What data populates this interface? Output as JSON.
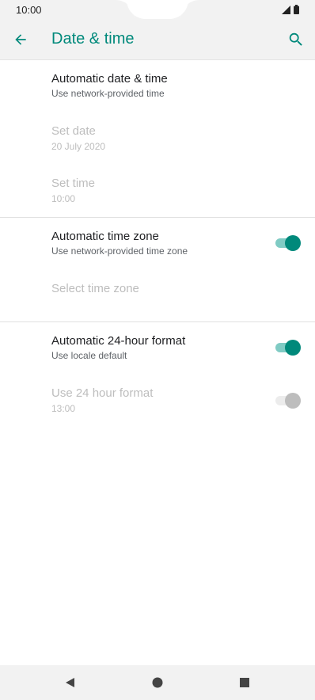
{
  "status_bar": {
    "time": "10:00"
  },
  "app_bar": {
    "title": "Date & time"
  },
  "settings": {
    "auto_date_time": {
      "title": "Automatic date & time",
      "subtitle": "Use network-provided time"
    },
    "set_date": {
      "title": "Set date",
      "subtitle": "20 July 2020"
    },
    "set_time": {
      "title": "Set time",
      "subtitle": "10:00"
    },
    "auto_time_zone": {
      "title": "Automatic time zone",
      "subtitle": "Use network-provided time zone",
      "enabled": true
    },
    "select_time_zone": {
      "title": "Select time zone"
    },
    "auto_24h": {
      "title": "Automatic 24-hour format",
      "subtitle": "Use locale default",
      "enabled": true
    },
    "use_24h": {
      "title": "Use 24 hour format",
      "subtitle": "13:00",
      "enabled": false
    }
  },
  "colors": {
    "accent": "#00897b",
    "accent_track": "#80cbc4",
    "disabled_text": "#bdbdbd"
  }
}
